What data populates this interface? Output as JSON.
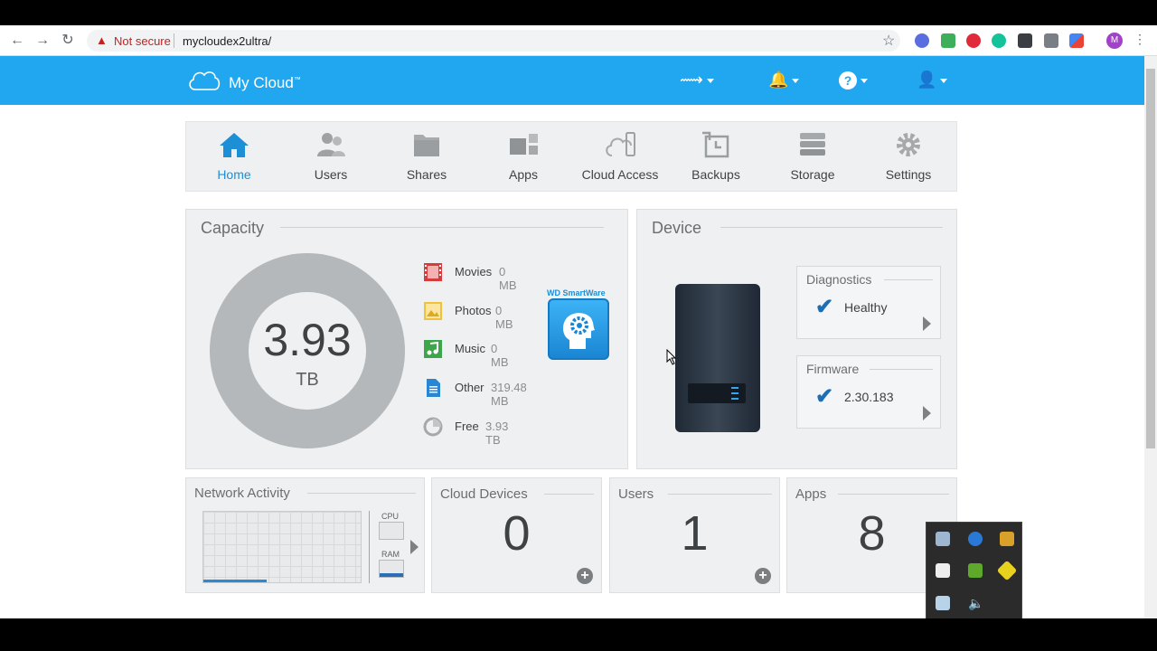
{
  "browser": {
    "security_label": "Not secure",
    "url": "mycloudex2ultra/",
    "profile_initial": "M"
  },
  "app": {
    "logo": "My Cloud",
    "logo_mark": "™",
    "accent": "#20a7f0"
  },
  "nav": {
    "tabs": [
      {
        "label": "Home",
        "icon": "home-icon",
        "active": true
      },
      {
        "label": "Users",
        "icon": "users-icon"
      },
      {
        "label": "Shares",
        "icon": "folder-icon"
      },
      {
        "label": "Apps",
        "icon": "apps-icon"
      },
      {
        "label": "Cloud Access",
        "icon": "cloud-device-icon"
      },
      {
        "label": "Backups",
        "icon": "backup-icon"
      },
      {
        "label": "Storage",
        "icon": "storage-icon"
      },
      {
        "label": "Settings",
        "icon": "gear-icon"
      }
    ]
  },
  "capacity": {
    "title": "Capacity",
    "total_value": "3.93",
    "total_unit": "TB",
    "items": [
      {
        "name": "Movies",
        "value": "0 MB",
        "icon": "movie-icon"
      },
      {
        "name": "Photos",
        "value": "0 MB",
        "icon": "photo-icon"
      },
      {
        "name": "Music",
        "value": "0 MB",
        "icon": "music-icon"
      },
      {
        "name": "Other",
        "value": "319.48 MB",
        "icon": "document-icon"
      },
      {
        "name": "Free",
        "value": "3.93 TB",
        "icon": "pie-icon"
      }
    ],
    "smartware_label": "WD SmartWare"
  },
  "device": {
    "title": "Device",
    "diagnostics": {
      "title": "Diagnostics",
      "value": "Healthy"
    },
    "firmware": {
      "title": "Firmware",
      "value": "2.30.183"
    }
  },
  "network_activity": {
    "title": "Network Activity",
    "cpu_label": "CPU",
    "ram_label": "RAM",
    "ram_level": 0.2
  },
  "cloud_devices": {
    "title": "Cloud Devices",
    "value": "0"
  },
  "users": {
    "title": "Users",
    "value": "1"
  },
  "apps": {
    "title": "Apps",
    "value": "8"
  }
}
